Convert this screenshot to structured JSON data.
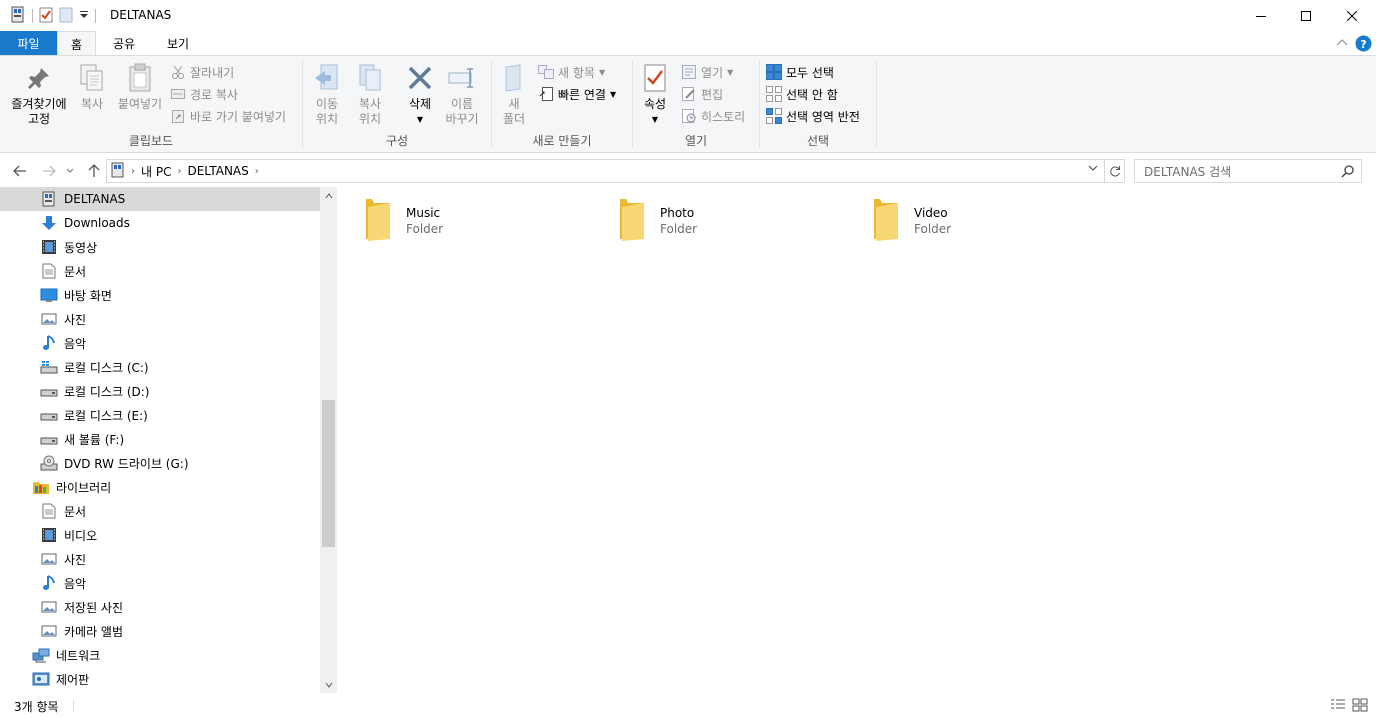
{
  "window": {
    "title": "DELTANAS",
    "minimize_icon": "minimize-icon",
    "maximize_icon": "maximize-icon",
    "close_icon": "close-icon"
  },
  "ribbon_tabs": {
    "file": "파일",
    "home": "홈",
    "share": "공유",
    "view": "보기"
  },
  "ribbon": {
    "clipboard": {
      "label": "클립보드",
      "pin_line1": "즐겨찾기에",
      "pin_line2": "고정",
      "copy": "복사",
      "paste": "붙여넣기",
      "cut": "잘라내기",
      "copy_path": "경로 복사",
      "paste_shortcut": "바로 가기 붙여넣기"
    },
    "organize": {
      "label": "구성",
      "move_line1": "이동",
      "move_line2": "위치",
      "copyto_line1": "복사",
      "copyto_line2": "위치",
      "delete": "삭제",
      "rename_line1": "이름",
      "rename_line2": "바꾸기"
    },
    "new": {
      "label": "새로 만들기",
      "new_folder_line1": "새",
      "new_folder_line2": "폴더",
      "new_item": "새 항목",
      "easy_access": "빠른 연결"
    },
    "open": {
      "label": "열기",
      "properties": "속성",
      "open": "열기",
      "edit": "편집",
      "history": "히스토리"
    },
    "select": {
      "label": "선택",
      "select_all": "모두 선택",
      "select_none": "선택 안 함",
      "invert": "선택 영역 반전"
    }
  },
  "address": {
    "crumbs": [
      "내 PC",
      "DELTANAS"
    ],
    "search_placeholder": "DELTANAS 검색"
  },
  "nav_pane": {
    "items": [
      {
        "label": "DELTANAS",
        "icon": "nas-drive-icon",
        "selected": true
      },
      {
        "label": "Downloads",
        "icon": "download-arrow-icon"
      },
      {
        "label": "동영상",
        "icon": "video-folder-icon"
      },
      {
        "label": "문서",
        "icon": "document-icon"
      },
      {
        "label": "바탕 화면",
        "icon": "desktop-icon"
      },
      {
        "label": "사진",
        "icon": "picture-icon"
      },
      {
        "label": "음악",
        "icon": "music-note-icon"
      },
      {
        "label": "로컬 디스크 (C:)",
        "icon": "windows-drive-icon"
      },
      {
        "label": "로컬 디스크 (D:)",
        "icon": "drive-icon"
      },
      {
        "label": "로컬 디스크 (E:)",
        "icon": "drive-icon"
      },
      {
        "label": "새 볼륨 (F:)",
        "icon": "drive-icon"
      },
      {
        "label": "DVD RW 드라이브 (G:)",
        "icon": "dvd-drive-icon"
      },
      {
        "label": "라이브러리",
        "icon": "library-icon"
      },
      {
        "label": "문서",
        "icon": "document-icon"
      },
      {
        "label": "비디오",
        "icon": "video-folder-icon"
      },
      {
        "label": "사진",
        "icon": "picture-icon"
      },
      {
        "label": "음악",
        "icon": "music-note-icon"
      },
      {
        "label": "저장된 사진",
        "icon": "picture-icon"
      },
      {
        "label": "카메라 앨범",
        "icon": "picture-icon"
      },
      {
        "label": "네트워크",
        "icon": "network-icon"
      },
      {
        "label": "제어판",
        "icon": "control-panel-icon"
      }
    ]
  },
  "content": {
    "folders": [
      {
        "name": "Music",
        "type": "Folder"
      },
      {
        "name": "Photo",
        "type": "Folder"
      },
      {
        "name": "Video",
        "type": "Folder"
      }
    ]
  },
  "status": {
    "item_count": "3개 항목"
  },
  "colors": {
    "accent": "#1979ca",
    "folder": "#f8d775",
    "selected_bg": "#d9d9d9"
  }
}
